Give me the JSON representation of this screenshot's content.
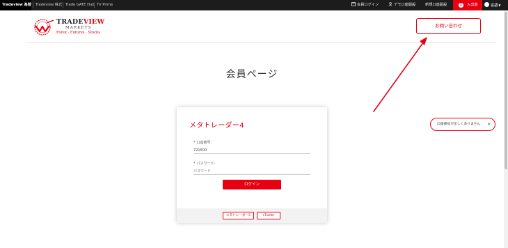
{
  "topbar": {
    "tabs": [
      {
        "label": "Tradeview 為替"
      },
      {
        "label": "Tradeview 株式"
      },
      {
        "label": "Trade GATE Hub"
      },
      {
        "label": "TV Prime"
      }
    ],
    "member_login": "会員ログイン",
    "demo_account": "デモ口座開設",
    "new_account": "新規口座開設",
    "deposit": {
      "badge": "2",
      "label": "入出金"
    },
    "language": "言語"
  },
  "logo": {
    "brand_a": "TRADE",
    "brand_b": "VIEW",
    "sub": "MARKETS",
    "tagline": "Forex · Futures · Stocks"
  },
  "header": {
    "contact_label": "お問い合わせ"
  },
  "page": {
    "title": "会員ページ"
  },
  "login": {
    "title": "メタトレーダー4",
    "account_label": "口座番号:",
    "account_value": "721500",
    "password_label": "パスワード:",
    "password_placeholder": "パスワード",
    "login_button": "ログイン",
    "footer_tabs": [
      "メタトレーダー5",
      "cTrader"
    ]
  },
  "toast": {
    "message": "口座番号が正しくありません",
    "close": "×"
  },
  "colors": {
    "accent": "#e60012",
    "topbar_bg": "#1c1c1c"
  }
}
